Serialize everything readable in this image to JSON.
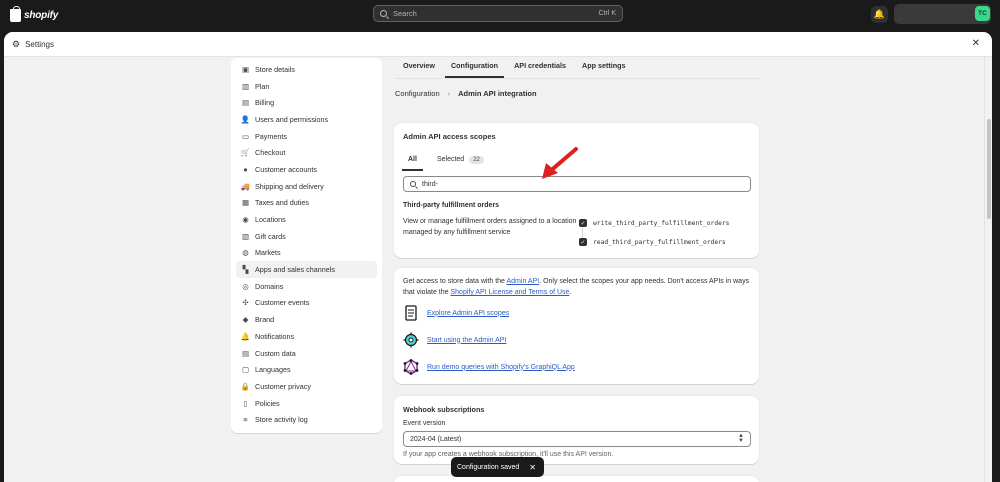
{
  "topbar": {
    "brand": "shopify",
    "search_placeholder": "Search",
    "search_shortcut": "Ctrl K",
    "avatar_initials": "TC"
  },
  "modal": {
    "title": "Settings"
  },
  "sidebar": {
    "items": [
      {
        "label": "Store details",
        "icon": "store-icon",
        "glyph": "▣"
      },
      {
        "label": "Plan",
        "icon": "plan-icon",
        "glyph": "▥"
      },
      {
        "label": "Billing",
        "icon": "billing-icon",
        "glyph": "▤"
      },
      {
        "label": "Users and permissions",
        "icon": "users-icon",
        "glyph": "👤"
      },
      {
        "label": "Payments",
        "icon": "payments-icon",
        "glyph": "▭"
      },
      {
        "label": "Checkout",
        "icon": "checkout-icon",
        "glyph": "🛒"
      },
      {
        "label": "Customer accounts",
        "icon": "customer-accounts-icon",
        "glyph": "●"
      },
      {
        "label": "Shipping and delivery",
        "icon": "shipping-icon",
        "glyph": "🚚"
      },
      {
        "label": "Taxes and duties",
        "icon": "taxes-icon",
        "glyph": "▦"
      },
      {
        "label": "Locations",
        "icon": "locations-icon",
        "glyph": "◉"
      },
      {
        "label": "Gift cards",
        "icon": "gift-cards-icon",
        "glyph": "▧"
      },
      {
        "label": "Markets",
        "icon": "markets-icon",
        "glyph": "◍"
      },
      {
        "label": "Apps and sales channels",
        "icon": "apps-icon",
        "glyph": "▚"
      },
      {
        "label": "Domains",
        "icon": "domains-icon",
        "glyph": "◎"
      },
      {
        "label": "Customer events",
        "icon": "customer-events-icon",
        "glyph": "✣"
      },
      {
        "label": "Brand",
        "icon": "brand-icon",
        "glyph": "◆"
      },
      {
        "label": "Notifications",
        "icon": "notifications-icon",
        "glyph": "🔔"
      },
      {
        "label": "Custom data",
        "icon": "custom-data-icon",
        "glyph": "▤"
      },
      {
        "label": "Languages",
        "icon": "languages-icon",
        "glyph": "▢"
      },
      {
        "label": "Customer privacy",
        "icon": "privacy-icon",
        "glyph": "🔒"
      },
      {
        "label": "Policies",
        "icon": "policies-icon",
        "glyph": "▯"
      },
      {
        "label": "Store activity log",
        "icon": "activity-log-icon",
        "glyph": "≡"
      }
    ],
    "active_index": 12
  },
  "tabs": [
    "Overview",
    "Configuration",
    "API credentials",
    "App settings"
  ],
  "active_tab": 1,
  "breadcrumb": {
    "parent": "Configuration",
    "current": "Admin API integration"
  },
  "scopes_card": {
    "title": "Admin API access scopes",
    "tab_all": "All",
    "tab_selected": "Selected",
    "selected_count": "22",
    "filter_value": "third-",
    "group_title": "Third-party fulfillment orders",
    "group_desc": "View or manage fulfillment orders assigned to a location managed by any fulfillment service",
    "scopes": [
      "write_third_party_fulfillment_orders",
      "read_third_party_fulfillment_orders"
    ]
  },
  "info_card": {
    "intro_1": "Get access to store data with the ",
    "intro_link_1": "Admin API",
    "intro_2": ". Only select the scopes your app needs. Don't access APIs in ways that violate the ",
    "intro_link_2": "Shopify API License and Terms of Use",
    "intro_3": ".",
    "links": [
      "Explore Admin API scopes",
      "Start using the Admin API",
      "Run demo queries with Shopify's GraphiQL App"
    ]
  },
  "webhook_card": {
    "title": "Webhook subscriptions",
    "label": "Event version",
    "selected_version": "2024-04 (Latest)",
    "help_start": "If your app creates a webhook subscription, it'll use this API version."
  },
  "toast": {
    "message": "Configuration saved"
  },
  "colors": {
    "accent_link": "#2c5cc5",
    "annotation_arrow": "#e01e1e",
    "avatar_bg": "#39d98a"
  }
}
